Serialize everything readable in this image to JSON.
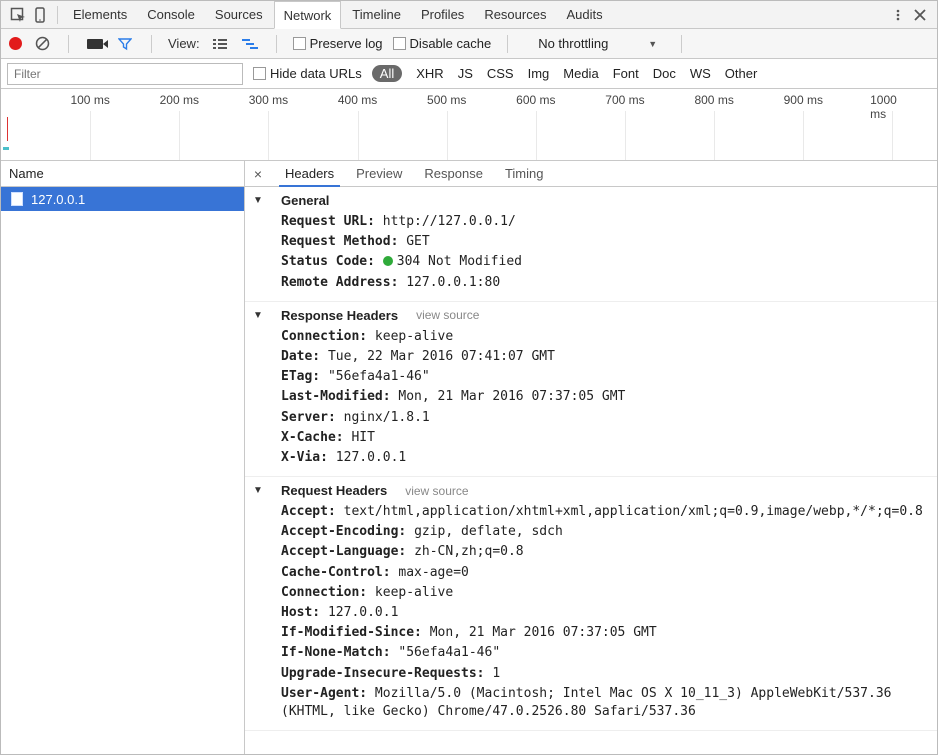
{
  "topbar": {
    "tabs": [
      "Elements",
      "Console",
      "Sources",
      "Network",
      "Timeline",
      "Profiles",
      "Resources",
      "Audits"
    ],
    "active_tab_index": 3
  },
  "toolbar": {
    "view_label": "View:",
    "preserve_log": "Preserve log",
    "disable_cache": "Disable cache",
    "throttling": "No throttling"
  },
  "filterbar": {
    "filter_placeholder": "Filter",
    "hide_data_urls": "Hide data URLs",
    "types": [
      "All",
      "XHR",
      "JS",
      "CSS",
      "Img",
      "Media",
      "Font",
      "Doc",
      "WS",
      "Other"
    ],
    "active_type_index": 0
  },
  "timeline": {
    "ticks": [
      "100 ms",
      "200 ms",
      "300 ms",
      "400 ms",
      "500 ms",
      "600 ms",
      "700 ms",
      "800 ms",
      "900 ms",
      "1000 ms"
    ]
  },
  "names": {
    "column_header": "Name",
    "rows": [
      "127.0.0.1"
    ]
  },
  "detail": {
    "tabs": [
      "Headers",
      "Preview",
      "Response",
      "Timing"
    ],
    "active_tab_index": 0,
    "sections": {
      "general": {
        "title": "General",
        "items": [
          {
            "k": "Request URL:",
            "v": "http://127.0.0.1/"
          },
          {
            "k": "Request Method:",
            "v": "GET"
          },
          {
            "k": "Status Code:",
            "v": "304 Not Modified",
            "status": true
          },
          {
            "k": "Remote Address:",
            "v": "127.0.0.1:80"
          }
        ]
      },
      "response_headers": {
        "title": "Response Headers",
        "view_source": "view source",
        "items": [
          {
            "k": "Connection:",
            "v": "keep-alive"
          },
          {
            "k": "Date:",
            "v": "Tue, 22 Mar 2016 07:41:07 GMT"
          },
          {
            "k": "ETag:",
            "v": "\"56efa4a1-46\""
          },
          {
            "k": "Last-Modified:",
            "v": "Mon, 21 Mar 2016 07:37:05 GMT"
          },
          {
            "k": "Server:",
            "v": "nginx/1.8.1"
          },
          {
            "k": "X-Cache:",
            "v": "HIT"
          },
          {
            "k": "X-Via:",
            "v": "127.0.0.1"
          }
        ]
      },
      "request_headers": {
        "title": "Request Headers",
        "view_source": "view source",
        "items": [
          {
            "k": "Accept:",
            "v": "text/html,application/xhtml+xml,application/xml;q=0.9,image/webp,*/*;q=0.8"
          },
          {
            "k": "Accept-Encoding:",
            "v": "gzip, deflate, sdch"
          },
          {
            "k": "Accept-Language:",
            "v": "zh-CN,zh;q=0.8"
          },
          {
            "k": "Cache-Control:",
            "v": "max-age=0"
          },
          {
            "k": "Connection:",
            "v": "keep-alive"
          },
          {
            "k": "Host:",
            "v": "127.0.0.1"
          },
          {
            "k": "If-Modified-Since:",
            "v": "Mon, 21 Mar 2016 07:37:05 GMT"
          },
          {
            "k": "If-None-Match:",
            "v": "\"56efa4a1-46\""
          },
          {
            "k": "Upgrade-Insecure-Requests:",
            "v": "1"
          },
          {
            "k": "User-Agent:",
            "v": "Mozilla/5.0 (Macintosh; Intel Mac OS X 10_11_3) AppleWebKit/537.36 (KHTML, like Gecko) Chrome/47.0.2526.80 Safari/537.36"
          }
        ]
      }
    }
  }
}
